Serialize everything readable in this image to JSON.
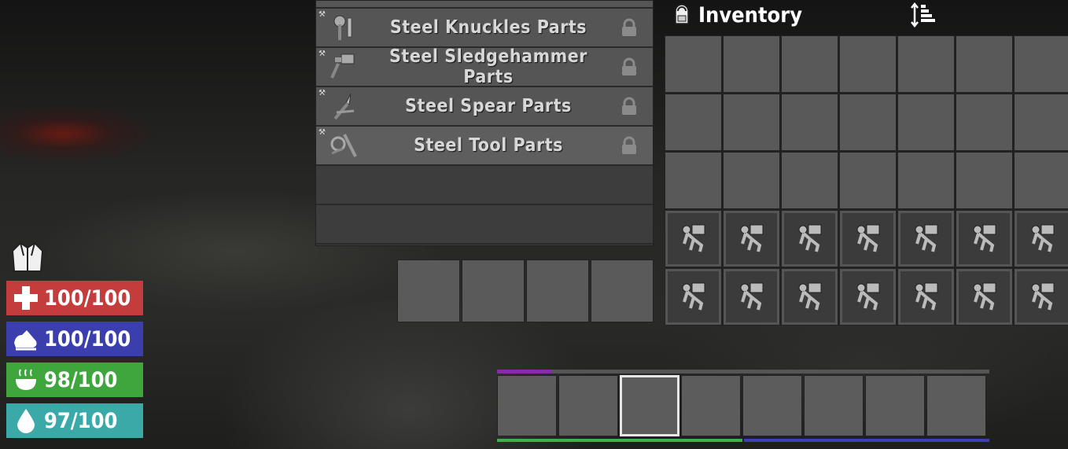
{
  "recipes": {
    "items": [
      {
        "name": "Steel Knuckles Parts",
        "locked": true,
        "icon": "steel-knuckles-parts-icon"
      },
      {
        "name": "Steel Sledgehammer Parts",
        "locked": true,
        "icon": "steel-sledgehammer-parts-icon"
      },
      {
        "name": "Steel Spear Parts",
        "locked": true,
        "icon": "steel-spear-parts-icon"
      },
      {
        "name": "Steel Tool Parts",
        "locked": true,
        "icon": "steel-tool-parts-icon"
      }
    ]
  },
  "inventory": {
    "title": "Inventory",
    "icon": "backpack-icon",
    "sort_icon": "sort-icon",
    "columns": 7,
    "open_rows": 3,
    "locked_rows": 2,
    "locked_icon": "encumbrance-icon"
  },
  "stats": {
    "armor_icon": "armor-jacket-icon",
    "health": {
      "value": "100/100",
      "color": "#c43d3d",
      "icon": "health-cross-icon"
    },
    "stamina": {
      "value": "100/100",
      "color": "#3b3fae",
      "icon": "stamina-shoe-icon"
    },
    "food": {
      "value": "98/100",
      "color": "#3fa53d",
      "icon": "food-bowl-icon"
    },
    "water": {
      "value": "97/100",
      "color": "#3aa9a8",
      "icon": "water-drop-icon"
    }
  },
  "toolbelt": {
    "slots": 8,
    "selected_index": 2,
    "xp_progress": 0.11,
    "xp_color": "#8b2aa8",
    "health_strip_color": "#3fb04a",
    "stamina_strip_color": "#3b3fb8"
  }
}
